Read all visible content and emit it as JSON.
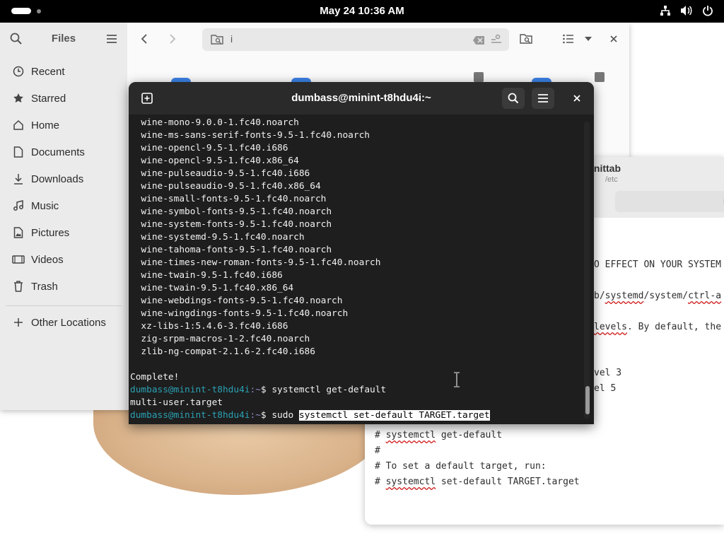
{
  "topbar": {
    "clock": "May 24  10:36 AM",
    "tray_icons": [
      "network-icon",
      "volume-icon",
      "power-icon"
    ]
  },
  "files": {
    "title": "Files",
    "sidebar": [
      {
        "label": "Recent",
        "icon": "clock-icon"
      },
      {
        "label": "Starred",
        "icon": "star-icon"
      },
      {
        "label": "Home",
        "icon": "home-icon"
      },
      {
        "label": "Documents",
        "icon": "document-icon"
      },
      {
        "label": "Downloads",
        "icon": "download-icon"
      },
      {
        "label": "Music",
        "icon": "music-icon"
      },
      {
        "label": "Pictures",
        "icon": "picture-icon"
      },
      {
        "label": "Videos",
        "icon": "video-icon"
      },
      {
        "label": "Trash",
        "icon": "trash-icon"
      },
      {
        "label": "Other Locations",
        "icon": "plus-icon"
      }
    ],
    "path_text": "i"
  },
  "editor": {
    "title": "inittab",
    "path": "/etc",
    "search_text": "i",
    "lines": [
      {
        "text": "O EFFECT ON YOUR SYSTEM"
      },
      {
        "pre": "b/",
        "sq": "systemd",
        "post": "/system/",
        "sq2": "ctrl-a",
        "post2": ""
      },
      {
        "pre": "",
        "sq": "levels",
        "post": ". By default, the"
      },
      {
        "text": "vel 3"
      },
      {
        "text": "el 5"
      },
      {
        "pre": "# ",
        "sq": "systemctl",
        "post": " get-default"
      },
      {
        "text": "#"
      },
      {
        "text": "# To set a default target, run:"
      },
      {
        "pre": "# ",
        "sq": "systemctl",
        "post": " set-default TARGET.target"
      }
    ]
  },
  "terminal": {
    "title": "dumbass@minint-t8hdu4i:~",
    "output_lines": [
      "  wine-mono-9.0.0-1.fc40.noarch",
      "  wine-ms-sans-serif-fonts-9.5-1.fc40.noarch",
      "  wine-opencl-9.5-1.fc40.i686",
      "  wine-opencl-9.5-1.fc40.x86_64",
      "  wine-pulseaudio-9.5-1.fc40.i686",
      "  wine-pulseaudio-9.5-1.fc40.x86_64",
      "  wine-small-fonts-9.5-1.fc40.noarch",
      "  wine-symbol-fonts-9.5-1.fc40.noarch",
      "  wine-system-fonts-9.5-1.fc40.noarch",
      "  wine-systemd-9.5-1.fc40.noarch",
      "  wine-tahoma-fonts-9.5-1.fc40.noarch",
      "  wine-times-new-roman-fonts-9.5-1.fc40.noarch",
      "  wine-twain-9.5-1.fc40.i686",
      "  wine-twain-9.5-1.fc40.x86_64",
      "  wine-webdings-fonts-9.5-1.fc40.noarch",
      "  wine-wingdings-fonts-9.5-1.fc40.noarch",
      "  xz-libs-1:5.4.6-3.fc40.i686",
      "  zig-srpm-macros-1-2.fc40.noarch",
      "  zlib-ng-compat-2.1.6-2.fc40.i686",
      "",
      "Complete!"
    ],
    "prompt_user": "dumbass@minint-t8hdu4i",
    "prompt_dir": ":~",
    "prompt_sym": "$ ",
    "cmd1": "systemctl get-default",
    "cmd1_out": "multi-user.target",
    "cmd2_prefix": "sudo ",
    "cmd2_selected": "systemctl set-default TARGET.target"
  }
}
